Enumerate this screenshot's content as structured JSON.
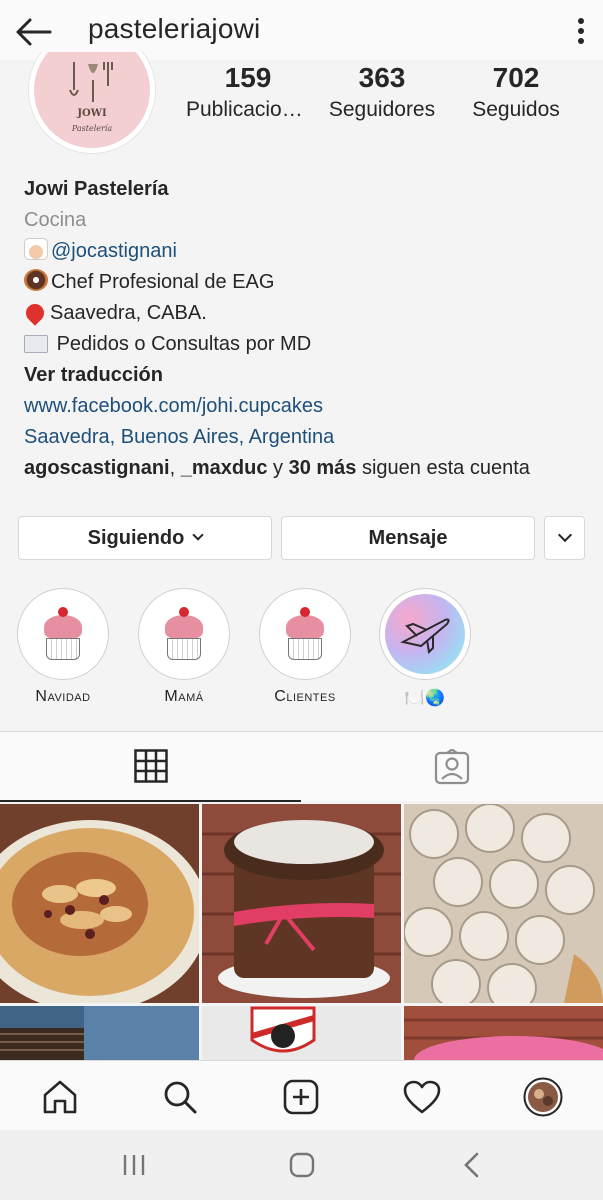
{
  "header": {
    "username": "pasteleriajowi",
    "back_icon": "arrow-left-icon",
    "more_icon": "more-vertical-icon"
  },
  "profile": {
    "avatar_brand": "JOWI",
    "avatar_subtitle": "Pastelería",
    "stats": [
      {
        "value": "159",
        "label": "Publicaciones"
      },
      {
        "value": "363",
        "label": "Seguidores"
      },
      {
        "value": "702",
        "label": "Seguidos"
      }
    ]
  },
  "bio": {
    "name": "Jowi Pastelería",
    "category": "Cocina",
    "mention": "@jocastignani",
    "line_chef": "Chef Profesional de EAG",
    "line_location": "Saavedra, CABA.",
    "line_orders": "Pedidos o Consultas por MD",
    "translate": "Ver traducción",
    "website": "www.facebook.com/johi.cupcakes",
    "address": "Saavedra, Buenos Aires, Argentina",
    "followed_by_1": "agoscastignani",
    "comma": ", ",
    "followed_by_2": "_maxduc",
    "and_word": " y ",
    "others": "30 más",
    "follow_suffix": " siguen esta cuenta"
  },
  "actions": {
    "following": "Siguiendo",
    "message": "Mensaje"
  },
  "highlights": [
    {
      "label": "Navidad"
    },
    {
      "label": "Mamá"
    },
    {
      "label": "Clientes"
    },
    {
      "label": "🍽️🌏"
    }
  ],
  "tabs": {
    "grid_icon": "grid-icon",
    "tagged_icon": "tagged-person-icon"
  },
  "bottom_nav": [
    "home-icon",
    "search-icon",
    "add-post-icon",
    "heart-icon",
    "profile-avatar"
  ],
  "colors": {
    "link": "#1e4f7a",
    "secondary_text": "#8e8e8e",
    "primary_text": "#262626",
    "avatar_pink": "#f3cfd2"
  }
}
